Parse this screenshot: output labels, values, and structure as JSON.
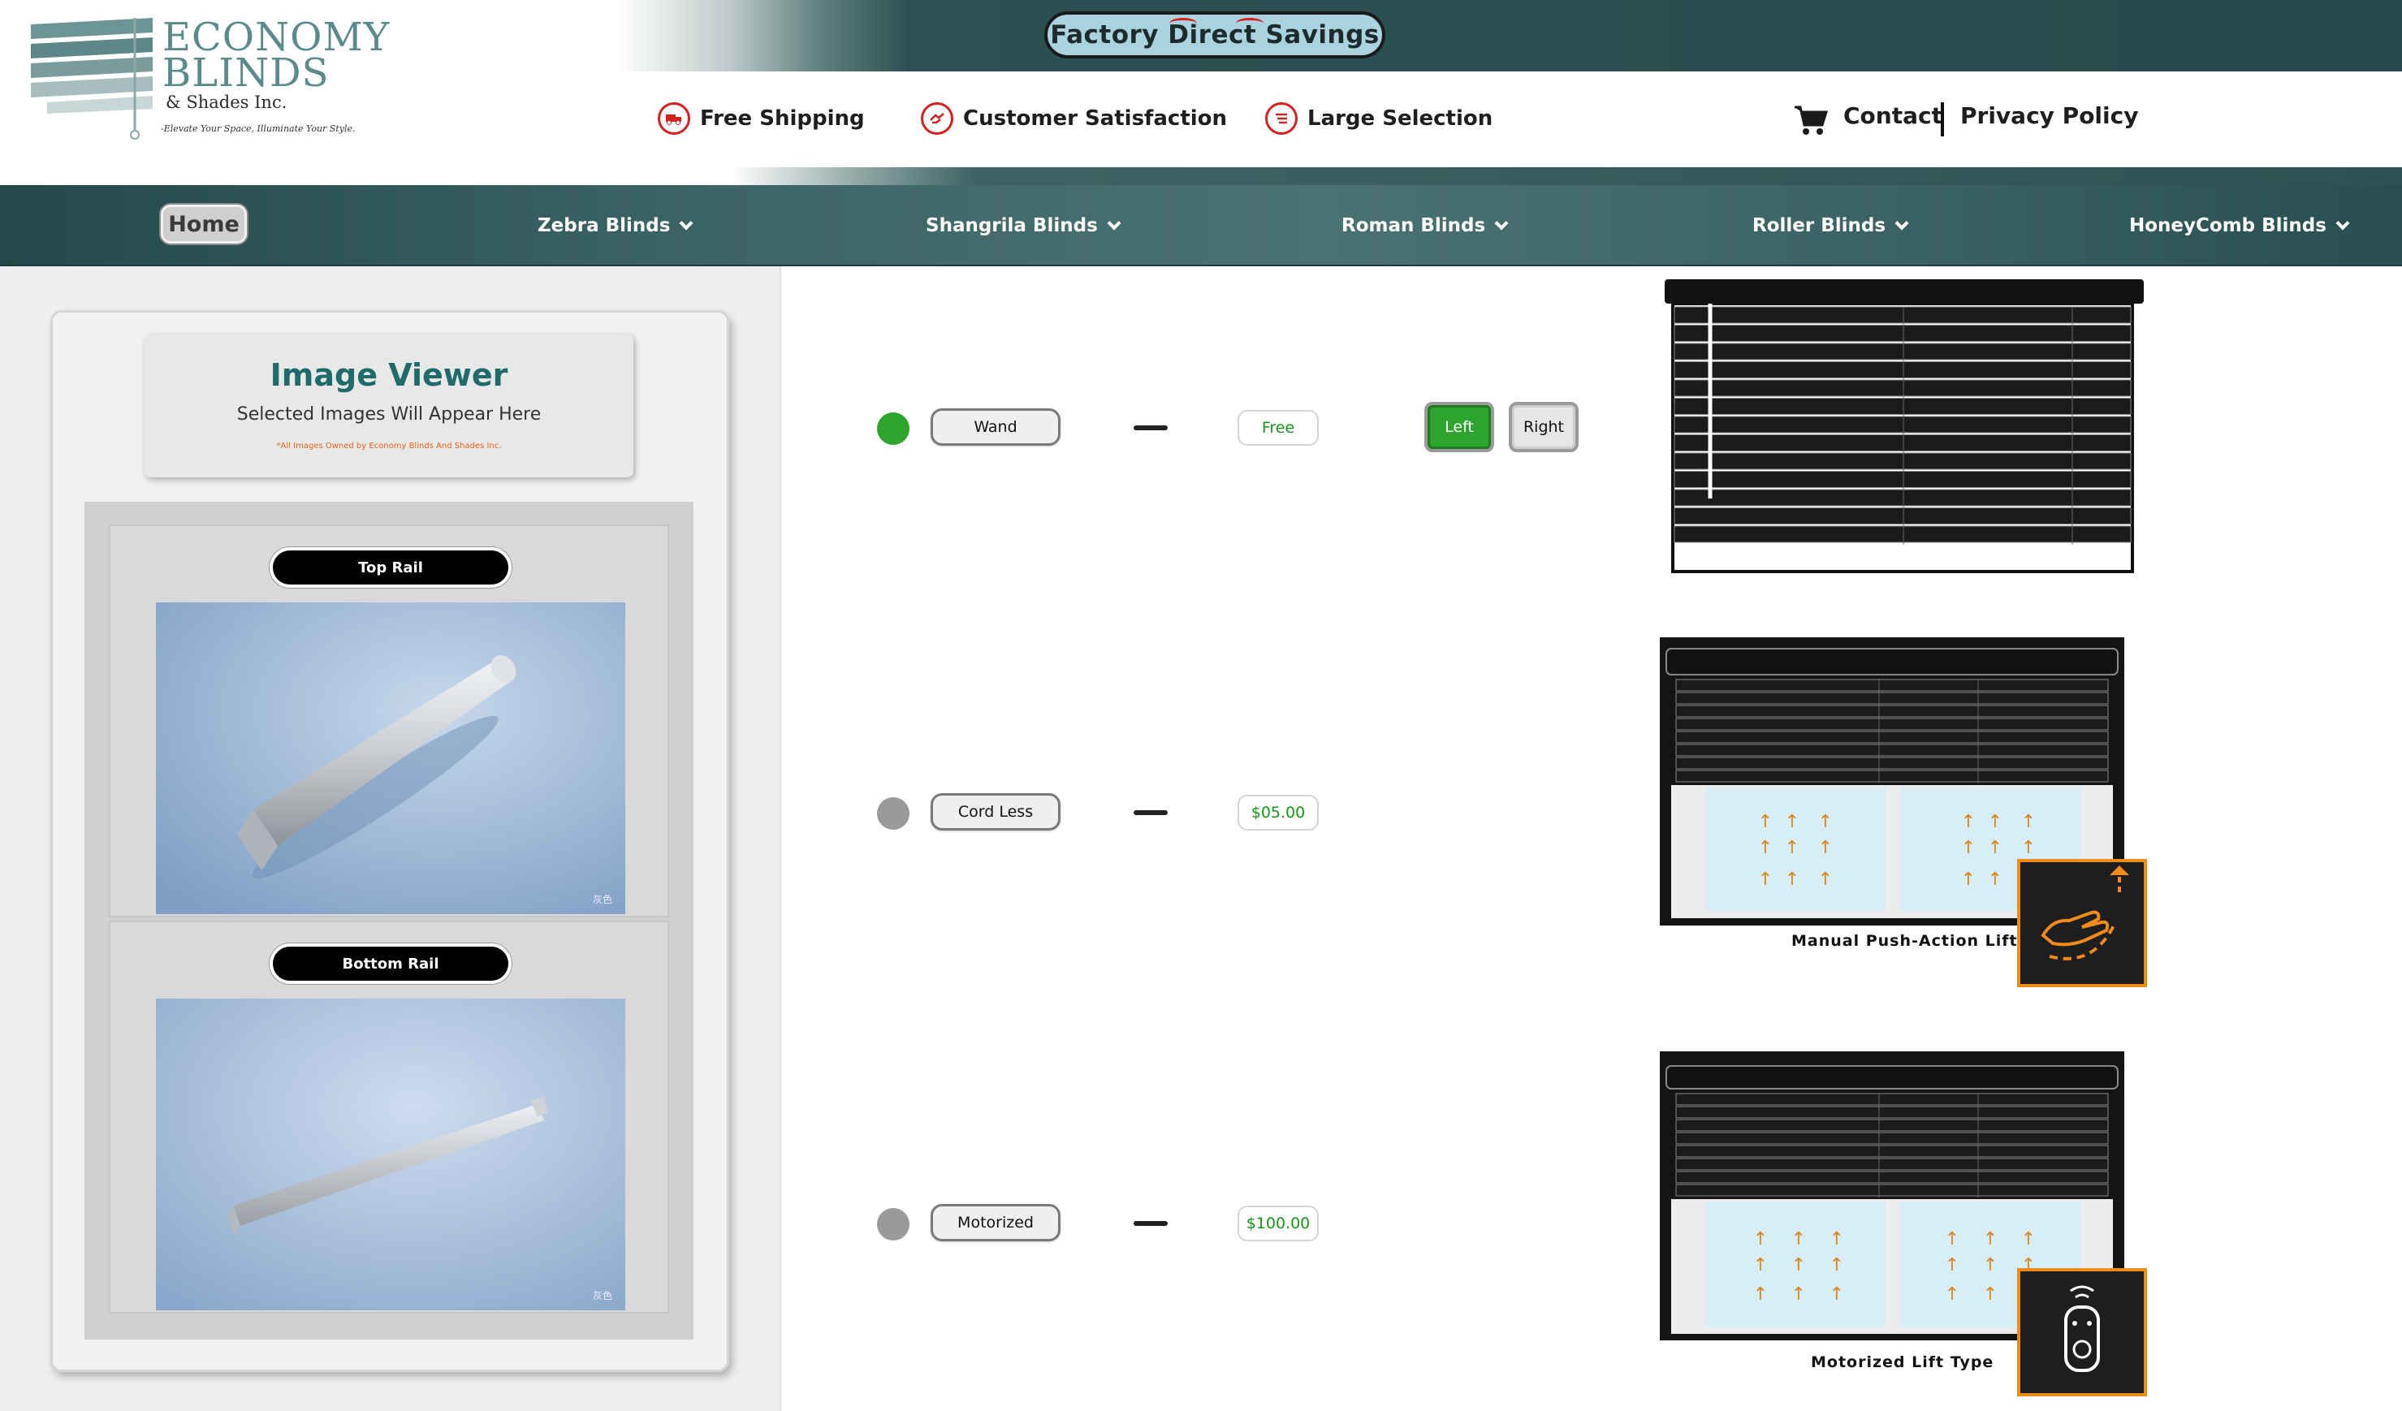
{
  "header": {
    "logo": {
      "title": "Economy Blinds",
      "subtitle": "& Shades Inc.",
      "tagline": "-Elevate Your Space, Illuminate Your Style."
    },
    "promo": "Factory Direct Savings",
    "features": [
      {
        "label": "Free Shipping",
        "icon": "truck-icon"
      },
      {
        "label": "Customer Satisfaction",
        "icon": "handshake-icon"
      },
      {
        "label": "Large Selection",
        "icon": "list-icon"
      }
    ],
    "contact": "Contact",
    "privacy": "Privacy Policy",
    "colors": {
      "teal_dark": "#244a4b",
      "teal_logo": "#5b8a8b",
      "promo_bg": "#a9d3df",
      "accent_red": "#d62020"
    }
  },
  "nav": {
    "home": "Home",
    "items": [
      "Zebra Blinds",
      "Shangrila Blinds",
      "Roman Blinds",
      "Roller Blinds",
      "HoneyComb Blinds"
    ]
  },
  "viewer": {
    "title": "Image Viewer",
    "subtitle": "Selected Images Will Appear Here",
    "note": "*All Images Owned by Economy Blinds And Shades Inc.",
    "items": [
      {
        "label": "Top Rail",
        "watermark": "灰色"
      },
      {
        "label": "Bottom Rail",
        "watermark": "灰色"
      }
    ]
  },
  "options": [
    {
      "label": "Wand",
      "price": "Free",
      "selected": true,
      "color": "#2ea42e"
    },
    {
      "label": "Cord Less",
      "price": "$05.00",
      "selected": false,
      "color": "#9a9a9a"
    },
    {
      "label": "Motorized",
      "price": "$100.00",
      "selected": false,
      "color": "#9a9a9a"
    }
  ],
  "wand_side": {
    "left": "Left",
    "right": "Right",
    "selected": "Left"
  },
  "illustrations": {
    "cordless_caption": "Manual Push-Action Lift",
    "motorized_caption": "Motorized Lift Type",
    "badge_border": "#ee8c1a"
  }
}
